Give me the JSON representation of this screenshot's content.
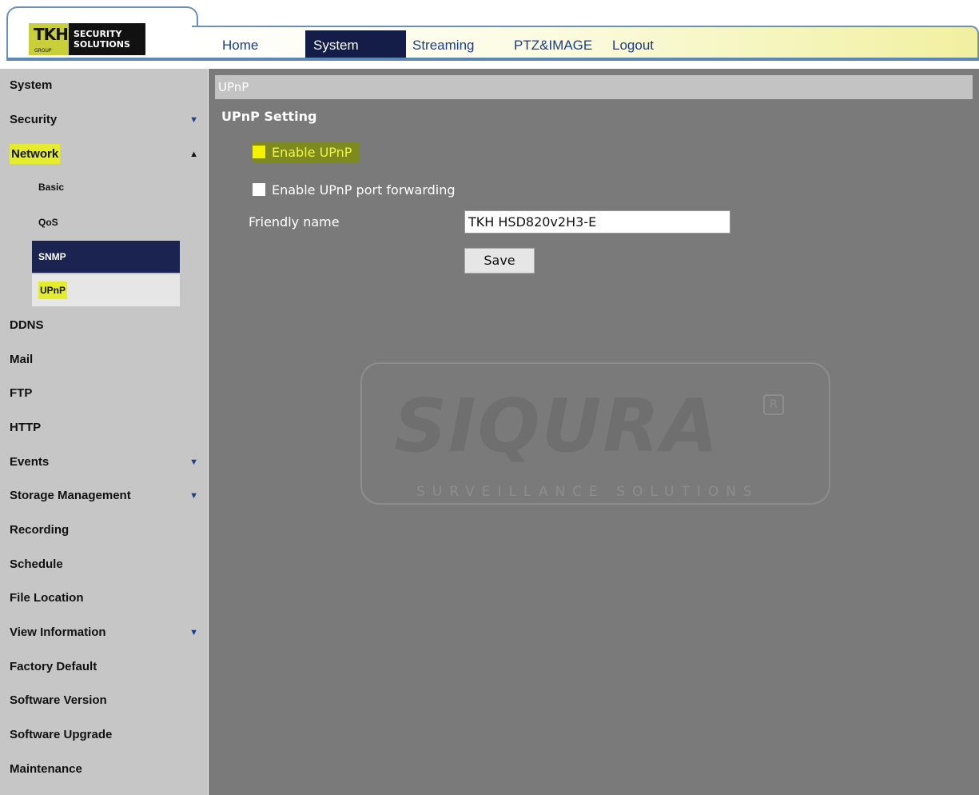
{
  "logo": {
    "brand": "TKH",
    "group": "GROUP",
    "line1": "SECURITY",
    "line2": "SOLUTIONS"
  },
  "nav": [
    "Home",
    "System",
    "Streaming",
    "PTZ&IMAGE",
    "Logout"
  ],
  "sidebar": {
    "items": [
      {
        "label": "System"
      },
      {
        "label": "Security",
        "arrow": "▼"
      },
      {
        "label": "Network",
        "arrow": "▲"
      },
      {
        "label": "DDNS"
      },
      {
        "label": "Mail"
      },
      {
        "label": "FTP"
      },
      {
        "label": "HTTP"
      },
      {
        "label": "Events",
        "arrow": "▼"
      },
      {
        "label": "Storage Management",
        "arrow": "▼"
      },
      {
        "label": "Recording"
      },
      {
        "label": "Schedule"
      },
      {
        "label": "File Location"
      },
      {
        "label": "View Information",
        "arrow": "▼"
      },
      {
        "label": "Factory Default"
      },
      {
        "label": "Software Version"
      },
      {
        "label": "Software Upgrade"
      },
      {
        "label": "Maintenance"
      }
    ],
    "subitems": [
      "Basic",
      "QoS",
      "SNMP",
      "UPnP"
    ]
  },
  "main": {
    "section": "UPnP",
    "title": "UPnP Setting",
    "enable_upnp": "Enable UPnP",
    "enable_port_forwarding": "Enable UPnP port forwarding",
    "friendly_name_label": "Friendly name",
    "friendly_name_value": "TKH HSD820v2H3-E",
    "save": "Save"
  },
  "watermark": {
    "brand": "SIQURA",
    "tagline": "SURVEILLANCE SOLUTIONS",
    "registered": "R"
  },
  "colors": {
    "nav_active": "#141d48",
    "sidebar_bg": "#c6c6c6",
    "main_bg": "#7a7a7a",
    "highlight": "#e5ec2e"
  }
}
